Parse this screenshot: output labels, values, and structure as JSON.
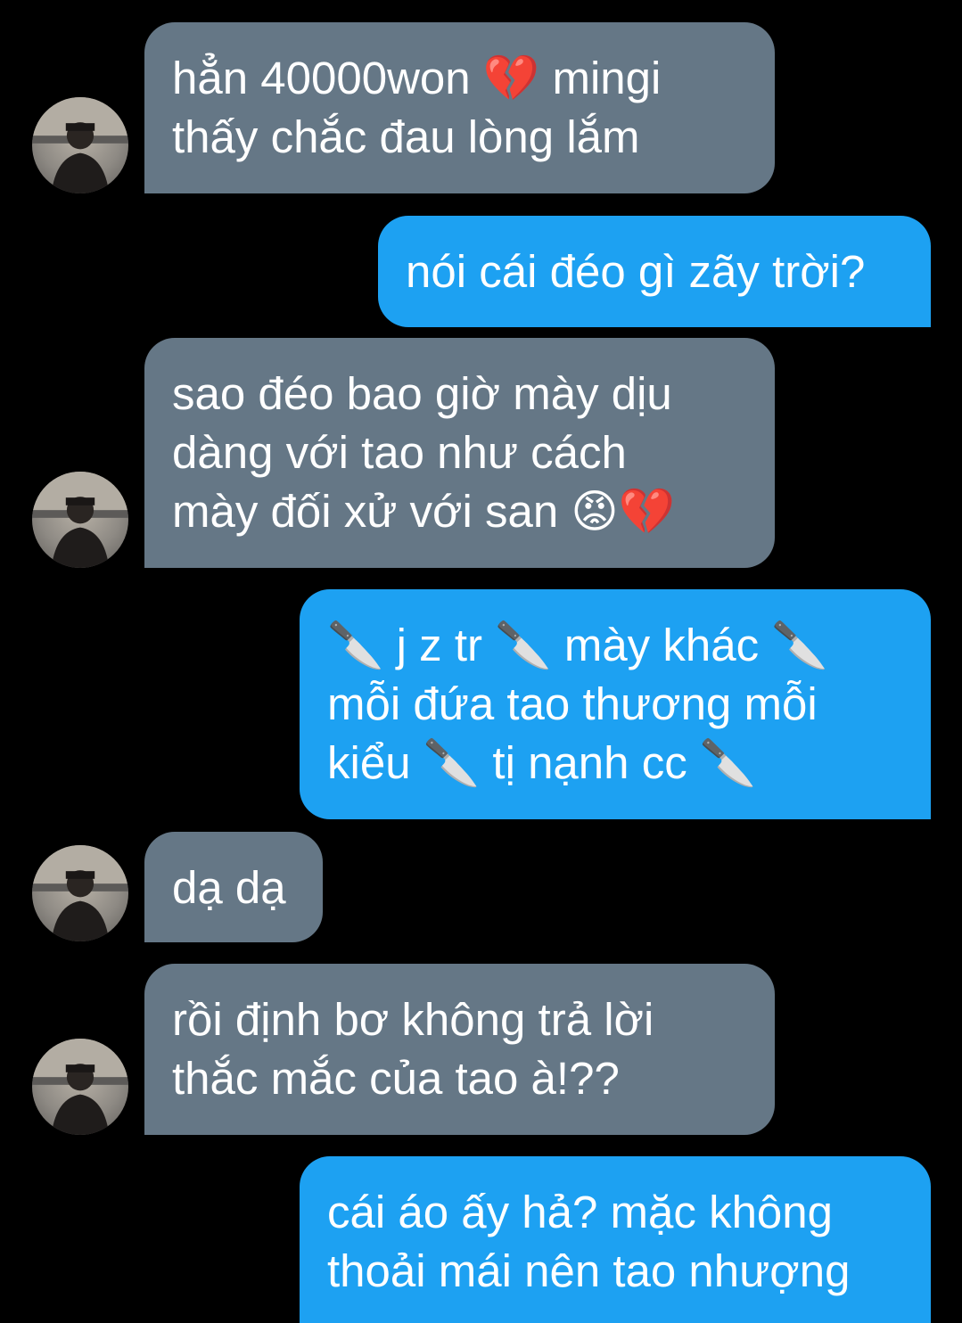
{
  "conversation": {
    "messages": [
      {
        "direction": "incoming",
        "text": "hẳn 40000won 💔 mingi\nthấy chắc đau lòng lắm"
      },
      {
        "direction": "outgoing",
        "text": "nói cái đéo gì zãy trời?"
      },
      {
        "direction": "incoming",
        "text": "sao đéo bao giờ mày dịu\ndàng với tao như cách\nmày đối xử với san 😡💔"
      },
      {
        "direction": "outgoing",
        "text": "🔪 j z tr 🔪 mày khác 🔪\nmỗi đứa tao thương mỗi\nkiểu 🔪 tị nạnh cc 🔪"
      },
      {
        "direction": "incoming",
        "text": "dạ dạ"
      },
      {
        "direction": "incoming",
        "text": "rồi định bơ không trả lời\nthắc mắc của tao à!??"
      },
      {
        "direction": "outgoing",
        "text": "cái áo ấy hả? mặc không\nthoải mái nên tao nhượng"
      }
    ]
  },
  "colors": {
    "background": "#000000",
    "incoming_bubble": "#657786",
    "outgoing_bubble": "#1da1f2",
    "text": "#ffffff"
  },
  "icons": {
    "avatar": "user-avatar-photo"
  }
}
